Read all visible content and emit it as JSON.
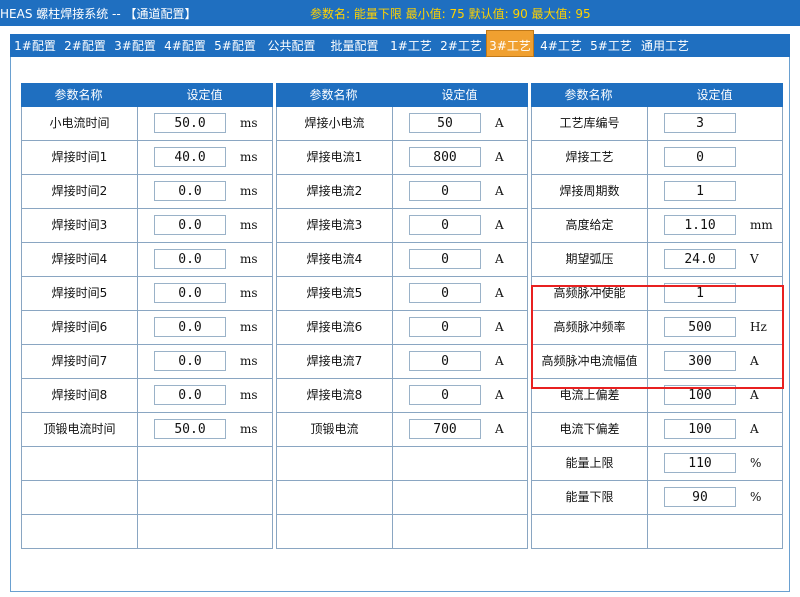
{
  "header": {
    "app_title": "HEAS 螺柱焊接系统 -- 【通道配置】",
    "param_info": "参数名: 能量下限  最小值: 75  默认值: 90  最大值: 95",
    "colors": {
      "bar": "#1f6fc0",
      "param_text": "#ffd200",
      "active_tab": "#f0a030",
      "highlight": "#e82020"
    }
  },
  "tabs": [
    {
      "label": "1#配置"
    },
    {
      "label": "2#配置"
    },
    {
      "label": "3#配置"
    },
    {
      "label": "4#配置"
    },
    {
      "label": "5#配置"
    },
    {
      "label": "公共配置"
    },
    {
      "label": "批量配置"
    },
    {
      "label": "1#工艺"
    },
    {
      "label": "2#工艺"
    },
    {
      "label": "3#工艺",
      "active": true
    },
    {
      "label": "4#工艺"
    },
    {
      "label": "5#工艺"
    },
    {
      "label": "通用工艺"
    }
  ],
  "tables": [
    {
      "headers": [
        "参数名称",
        "设定值"
      ],
      "rows": [
        {
          "name": "小电流时间",
          "value": "50.0",
          "unit": "ms"
        },
        {
          "name": "焊接时间1",
          "value": "40.0",
          "unit": "ms"
        },
        {
          "name": "焊接时间2",
          "value": "0.0",
          "unit": "ms"
        },
        {
          "name": "焊接时间3",
          "value": "0.0",
          "unit": "ms"
        },
        {
          "name": "焊接时间4",
          "value": "0.0",
          "unit": "ms"
        },
        {
          "name": "焊接时间5",
          "value": "0.0",
          "unit": "ms"
        },
        {
          "name": "焊接时间6",
          "value": "0.0",
          "unit": "ms"
        },
        {
          "name": "焊接时间7",
          "value": "0.0",
          "unit": "ms"
        },
        {
          "name": "焊接时间8",
          "value": "0.0",
          "unit": "ms"
        },
        {
          "name": "顶锻电流时间",
          "value": "50.0",
          "unit": "ms"
        },
        {
          "name": "",
          "value": null,
          "unit": ""
        },
        {
          "name": "",
          "value": null,
          "unit": ""
        },
        {
          "name": "",
          "value": null,
          "unit": ""
        }
      ]
    },
    {
      "headers": [
        "参数名称",
        "设定值"
      ],
      "rows": [
        {
          "name": "焊接小电流",
          "value": "50",
          "unit": "A"
        },
        {
          "name": "焊接电流1",
          "value": "800",
          "unit": "A"
        },
        {
          "name": "焊接电流2",
          "value": "0",
          "unit": "A"
        },
        {
          "name": "焊接电流3",
          "value": "0",
          "unit": "A"
        },
        {
          "name": "焊接电流4",
          "value": "0",
          "unit": "A"
        },
        {
          "name": "焊接电流5",
          "value": "0",
          "unit": "A"
        },
        {
          "name": "焊接电流6",
          "value": "0",
          "unit": "A"
        },
        {
          "name": "焊接电流7",
          "value": "0",
          "unit": "A"
        },
        {
          "name": "焊接电流8",
          "value": "0",
          "unit": "A"
        },
        {
          "name": "顶锻电流",
          "value": "700",
          "unit": "A"
        },
        {
          "name": "",
          "value": null,
          "unit": ""
        },
        {
          "name": "",
          "value": null,
          "unit": ""
        },
        {
          "name": "",
          "value": null,
          "unit": ""
        }
      ]
    },
    {
      "headers": [
        "参数名称",
        "设定值"
      ],
      "rows": [
        {
          "name": "工艺库编号",
          "value": "3",
          "unit": ""
        },
        {
          "name": "焊接工艺",
          "value": "0",
          "unit": ""
        },
        {
          "name": "焊接周期数",
          "value": "1",
          "unit": ""
        },
        {
          "name": "高度给定",
          "value": "1.10",
          "unit": "mm"
        },
        {
          "name": "期望弧压",
          "value": "24.0",
          "unit": "V"
        },
        {
          "name": "高频脉冲使能",
          "value": "1",
          "unit": ""
        },
        {
          "name": "高频脉冲频率",
          "value": "500",
          "unit": "Hz"
        },
        {
          "name": "高频脉冲电流幅值",
          "value": "300",
          "unit": "A"
        },
        {
          "name": "电流上偏差",
          "value": "100",
          "unit": "A"
        },
        {
          "name": "电流下偏差",
          "value": "100",
          "unit": "A"
        },
        {
          "name": "能量上限",
          "value": "110",
          "unit": "%"
        },
        {
          "name": "能量下限",
          "value": "90",
          "unit": "%"
        },
        {
          "name": "",
          "value": null,
          "unit": ""
        }
      ]
    }
  ]
}
